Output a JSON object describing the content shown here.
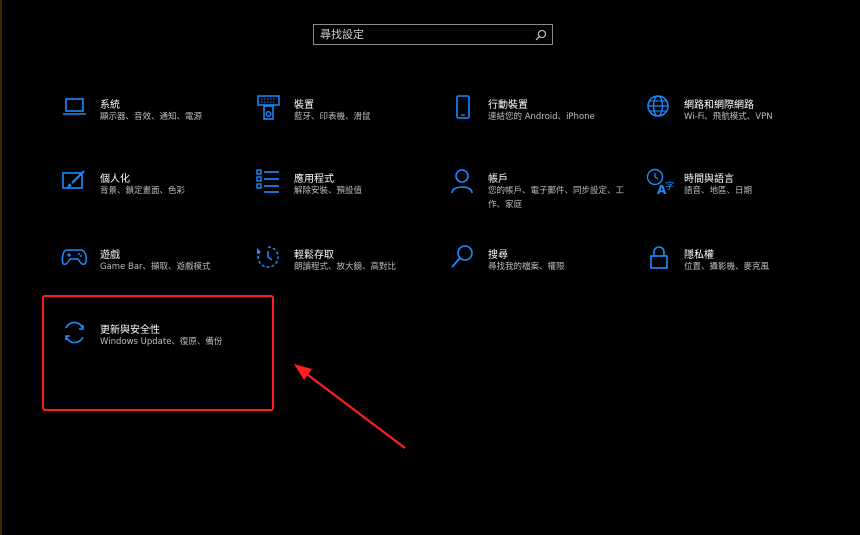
{
  "search": {
    "placeholder": "尋找設定"
  },
  "tiles": [
    {
      "title": "系統",
      "desc": "顯示器、音效、通知、電源"
    },
    {
      "title": "裝置",
      "desc": "藍牙、印表機、滑鼠"
    },
    {
      "title": "行動裝置",
      "desc": "連結您的 Android、iPhone"
    },
    {
      "title": "網路和網際網路",
      "desc": "Wi-Fi、飛航模式、VPN"
    },
    {
      "title": "個人化",
      "desc": "背景、鎖定畫面、色彩"
    },
    {
      "title": "應用程式",
      "desc": "解除安裝、預設值"
    },
    {
      "title": "帳戶",
      "desc": "您的帳戶、電子郵件、同步設定、工作、家庭"
    },
    {
      "title": "時間與語言",
      "desc": "語音、地區、日期"
    },
    {
      "title": "遊戲",
      "desc": "Game Bar、擷取、遊戲模式"
    },
    {
      "title": "輕鬆存取",
      "desc": "朗讀程式、放大鏡、高對比"
    },
    {
      "title": "搜尋",
      "desc": "尋找我的檔案、權限"
    },
    {
      "title": "隱私權",
      "desc": "位置、攝影機、麥克風"
    },
    {
      "title": "更新與安全性",
      "desc": "Windows Update、復原、備份"
    }
  ],
  "colors": {
    "accent": "#1a8cff",
    "highlight": "#ff1e1e",
    "background": "#000000"
  }
}
